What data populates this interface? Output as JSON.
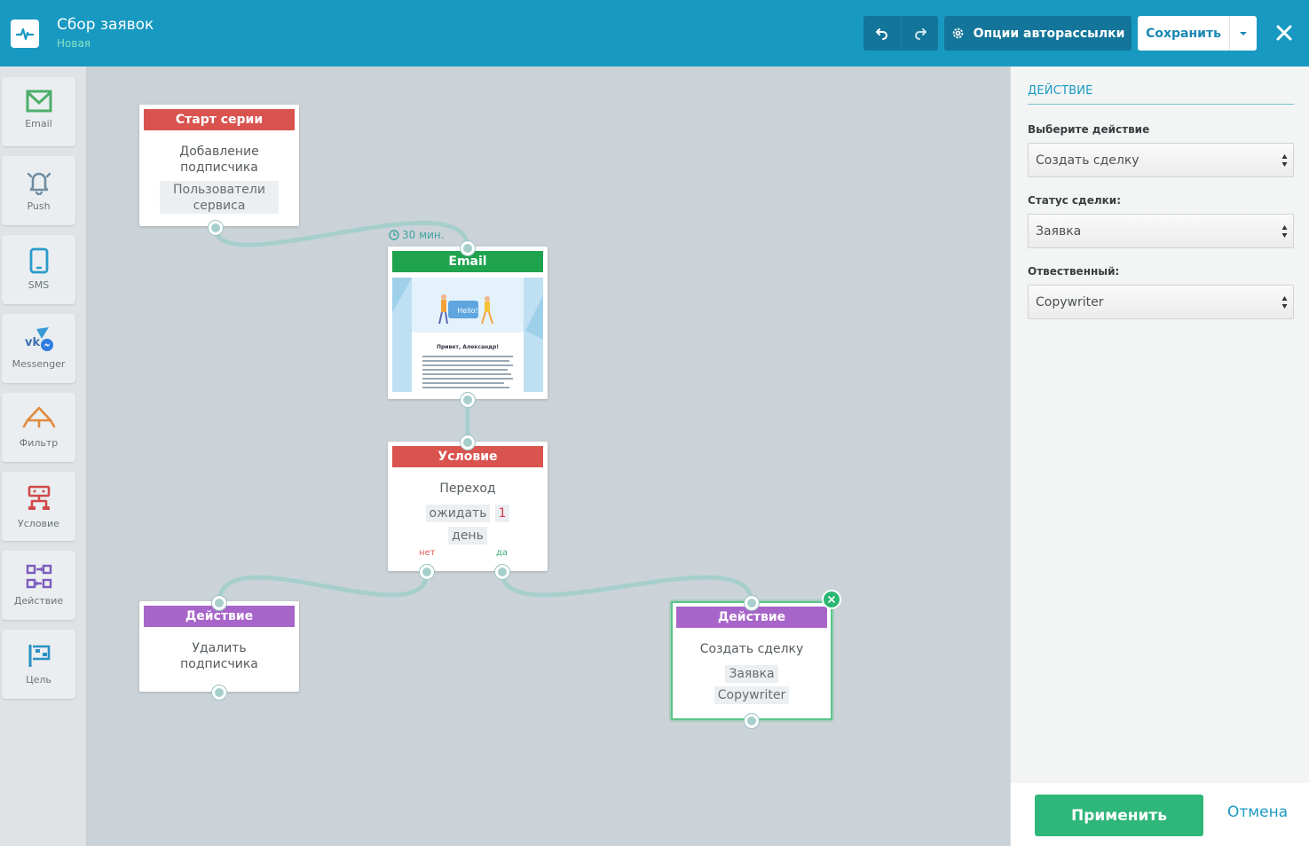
{
  "header": {
    "title": "Сбор заявок",
    "status": "Новая",
    "options_label": "Опции авторассылки",
    "save_label": "Сохранить",
    "color": "#1899c1"
  },
  "toolbox": [
    {
      "label": "Email",
      "icon": "envelope-icon",
      "color": "#4caf6a"
    },
    {
      "label": "Push",
      "icon": "bell-icon",
      "color": "#6f8ca0"
    },
    {
      "label": "SMS",
      "icon": "phone-icon",
      "color": "#2a9bc8"
    },
    {
      "label": "Messenger",
      "icon": "messenger-icon",
      "color": "#3a78c9"
    },
    {
      "label": "Фильтр",
      "icon": "filter-icon",
      "color": "#e08a3e"
    },
    {
      "label": "Условие",
      "icon": "condition-icon",
      "color": "#d24a4a"
    },
    {
      "label": "Действие",
      "icon": "action-icon",
      "color": "#7c5bbd"
    },
    {
      "label": "Цель",
      "icon": "flag-icon",
      "color": "#2a8fc4"
    }
  ],
  "nodes": {
    "start": {
      "header": "Старт серии",
      "title": "Добавление подписчика",
      "chip": "Пользователи сервиса",
      "color": "#d9534f"
    },
    "delay": "30 мин.",
    "email": {
      "header": "Email",
      "color": "#1fa34f",
      "preview_heading": "Привет, Александр!",
      "preview_bubble": "Hello!"
    },
    "condition": {
      "header": "Условие",
      "title": "Переход",
      "wait_label": "ожидать",
      "wait_value": "1",
      "unit": "день",
      "no_label": "нет",
      "yes_label": "да",
      "color": "#d9534f"
    },
    "action_delete": {
      "header": "Действие",
      "title": "Удалить подписчика",
      "color": "#a765c9"
    },
    "action_deal": {
      "header": "Действие",
      "title": "Создать сделку",
      "chip_status": "Заявка",
      "chip_owner": "Copywriter",
      "color": "#a765c9"
    }
  },
  "panel": {
    "title": "ДЕЙСТВИЕ",
    "action_label": "Выберите действие",
    "action_value": "Создать сделку",
    "status_label": "Статус сделки:",
    "status_value": "Заявка",
    "owner_label": "Отвественный:",
    "owner_value": "Copywriter",
    "apply_label": "Применить",
    "cancel_label": "Отмена"
  }
}
